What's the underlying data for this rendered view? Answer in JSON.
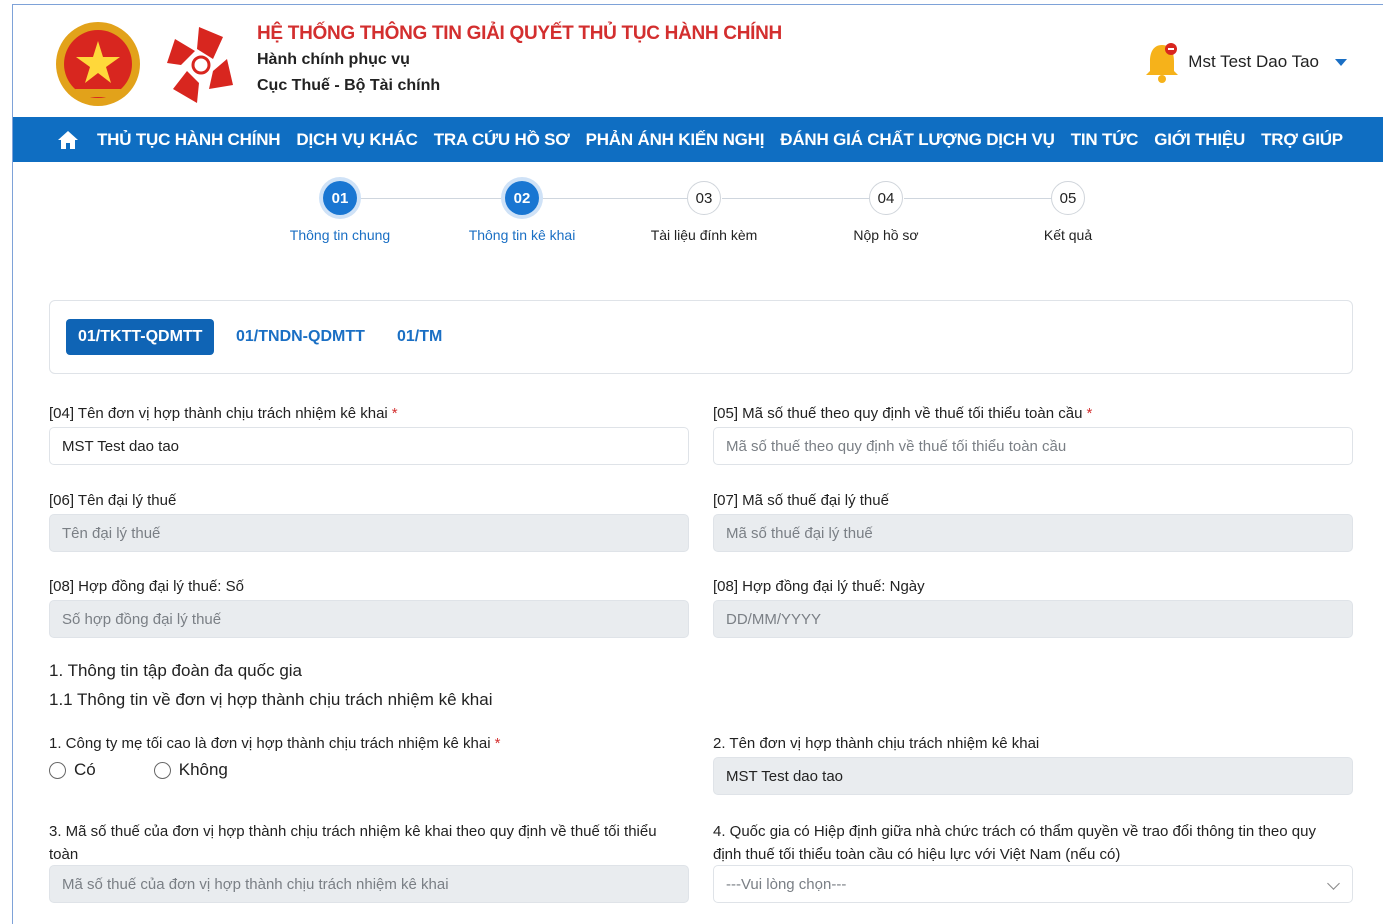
{
  "header": {
    "system_title": "HỆ THỐNG THÔNG TIN GIẢI QUYẾT THỦ TỤC HÀNH CHÍNH",
    "subtitle1": "Hành chính phục vụ",
    "subtitle2": "Cục Thuế - Bộ Tài chính",
    "user_name": "Mst Test Dao Tao"
  },
  "nav": {
    "items": [
      "THỦ TỤC HÀNH CHÍNH",
      "DỊCH VỤ KHÁC",
      "TRA CỨU HỒ SƠ",
      "PHẢN ÁNH KIẾN NGHỊ",
      "ĐÁNH GIÁ CHẤT LƯỢNG DỊCH VỤ",
      "TIN TỨC",
      "GIỚI THIỆU",
      "TRỢ GIÚP"
    ]
  },
  "stepper": {
    "steps": [
      {
        "number": "01",
        "label": "Thông tin chung"
      },
      {
        "number": "02",
        "label": "Thông tin kê khai"
      },
      {
        "number": "03",
        "label": "Tài liệu đính kèm"
      },
      {
        "number": "04",
        "label": "Nộp hồ sơ"
      },
      {
        "number": "05",
        "label": "Kết quả"
      }
    ]
  },
  "tabs": [
    "01/TKTT-QDMTT",
    "01/TNDN-QDMTT",
    "01/TM"
  ],
  "form": {
    "f04_label": "[04] Tên đơn vị hợp thành chịu trách nhiệm kê khai",
    "f04_value": "MST Test dao tao",
    "f05_label": "[05] Mã số thuế theo quy định về thuế tối thiểu toàn cầu",
    "f05_placeholder": "Mã số thuế theo quy định về thuế tối thiểu toàn cầu",
    "f06_label": "[06] Tên đại lý thuế",
    "f06_placeholder": "Tên đại lý thuế",
    "f07_label": "[07] Mã số thuế đại lý thuế",
    "f07_placeholder": "Mã số thuế đại lý thuế",
    "f08a_label": "[08] Hợp đồng đại lý thuế: Số",
    "f08a_placeholder": "Số hợp đồng đại lý thuế",
    "f08b_label": "[08] Hợp đồng đại lý thuế: Ngày",
    "f08b_placeholder": "DD/MM/YYYY",
    "section1": "1. Thông tin tập đoàn đa quốc gia",
    "section11": "1.1 Thông tin về đơn vị hợp thành chịu trách nhiệm kê khai",
    "q1_label": "1. Công ty mẹ tối cao là đơn vị hợp thành chịu trách nhiệm kê khai",
    "q1_yes": "Có",
    "q1_no": "Không",
    "q2_label": "2. Tên đơn vị hợp thành chịu trách nhiệm kê khai",
    "q2_value": "MST Test dao tao",
    "q3_label_line1": "3. Mã số thuế của đơn vị hợp thành chịu trách nhiệm kê khai theo quy định về thuế tối thiểu",
    "q3_label_line2": "toàn",
    "q3_placeholder": "Mã số thuế của đơn vị hợp thành chịu trách nhiệm kê khai",
    "q4_label_line1": "4. Quốc gia có Hiệp định giữa nhà chức trách có thẩm quyền về trao đổi thông tin theo quy",
    "q4_label_line2": "định thuế tối thiểu toàn cầu có hiệu lực với Việt Nam (nếu có)",
    "q4_placeholder": "---Vui lòng chọn---",
    "required_mark": "*"
  },
  "colors": {
    "brand_blue": "#0f6ec2",
    "title_red": "#d32f2f",
    "link_blue": "#1a6fc4"
  }
}
